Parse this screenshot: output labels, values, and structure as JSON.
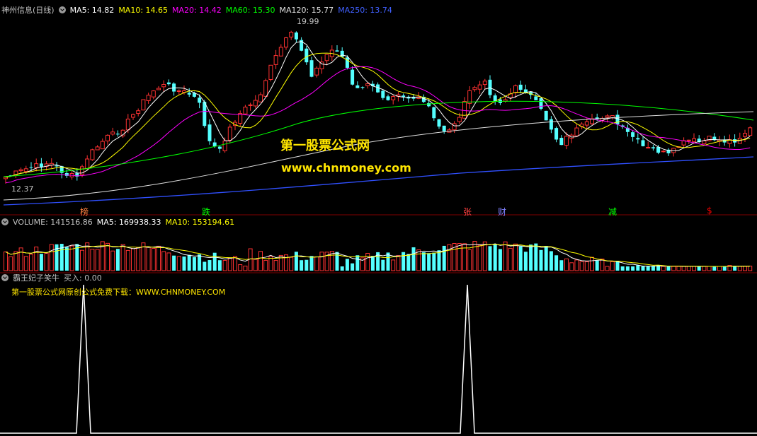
{
  "price": {
    "stock_name": "神州信息(日线)",
    "ma_labels": [
      {
        "text": "MA5: 14.82",
        "color": "#ffffff"
      },
      {
        "text": "MA10: 14.65",
        "color": "#ffff00"
      },
      {
        "text": "MA20: 14.42",
        "color": "#ff00ff"
      },
      {
        "text": "MA60: 15.30",
        "color": "#00ff00"
      },
      {
        "text": "MA120: 15.77",
        "color": "#e0e0e0"
      },
      {
        "text": "MA250: 13.74",
        "color": "#4060ff"
      }
    ],
    "high_label": "19.99",
    "low_label": "12.37",
    "watermark_cn": "第一股票公式网",
    "watermark_url": "www.chnmoney.com",
    "events": [
      {
        "text": "榜",
        "color": "#ff8040"
      },
      {
        "text": "跌",
        "color": "#00ff00"
      },
      {
        "text": "张",
        "color": "#ff4040"
      },
      {
        "text": "财",
        "color": "#8080ff"
      },
      {
        "text": "减",
        "color": "#00ff00"
      },
      {
        "text": "$",
        "color": "#ff0000"
      }
    ]
  },
  "volume": {
    "header": "VOLUME: 141516.86",
    "ma5": "MA5: 169938.33",
    "ma10": "MA10: 153194.61"
  },
  "indicator": {
    "title": "霸王妃子笑牛",
    "buy": "买入: 0.00",
    "note": "第一股票公式网原创公式免费下载：WWW.CHNMONEY.COM"
  },
  "colors": {
    "up": "#ff3232",
    "down": "#54ffff",
    "grid": "#800000"
  }
}
